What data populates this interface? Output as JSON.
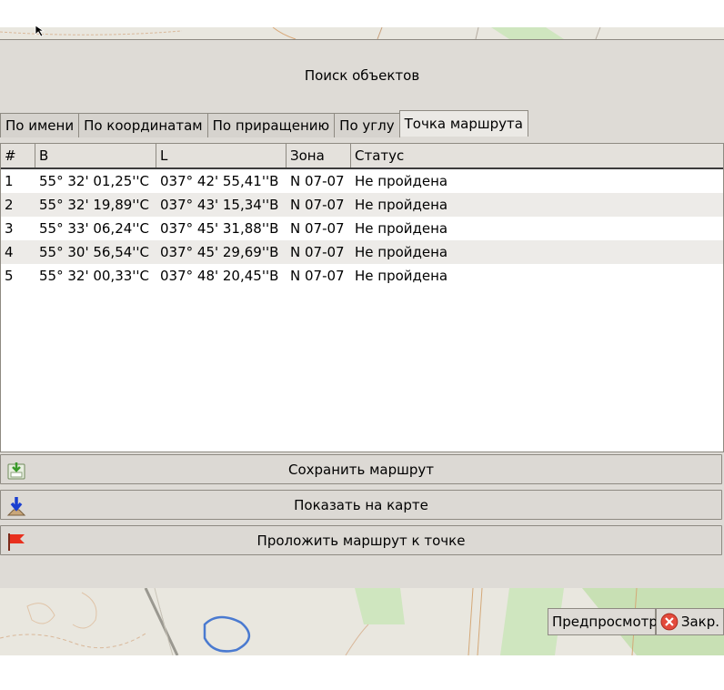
{
  "dialog": {
    "title": "Поиск объектов"
  },
  "tabs": [
    {
      "label": "По имени"
    },
    {
      "label": "По координатам"
    },
    {
      "label": "По приращению"
    },
    {
      "label": "По углу"
    },
    {
      "label": "Точка маршрута",
      "active": true
    }
  ],
  "table": {
    "columns": [
      "#",
      "B",
      "L",
      "Зона",
      "Статус"
    ],
    "rows": [
      [
        "1",
        "55° 32' 01,25''С",
        "037° 42' 55,41''В",
        "N 07-07",
        "Не пройдена"
      ],
      [
        "2",
        "55° 32' 19,89''С",
        "037° 43' 15,34''В",
        "N 07-07",
        "Не пройдена"
      ],
      [
        "3",
        "55° 33' 06,24''С",
        "037° 45' 31,88''В",
        "N 07-07",
        "Не пройдена"
      ],
      [
        "4",
        "55° 30' 56,54''С",
        "037° 45' 29,69''В",
        "N 07-07",
        "Не пройдена"
      ],
      [
        "5",
        "55° 32' 00,33''С",
        "037° 48' 20,45''В",
        "N 07-07",
        "Не пройдена"
      ]
    ]
  },
  "buttons": {
    "save_route": "Сохранить маршрут",
    "show_on_map": "Показать на карте",
    "route_to_point": "Проложить маршрут к точке",
    "preview": "Предпросмотр",
    "close": "Закр."
  },
  "icons": {
    "save": "save-route-icon",
    "show": "show-on-map-icon",
    "route": "red-flag-icon",
    "close": "close-circle-icon"
  },
  "colors": {
    "map_green": "#b9d9a4",
    "flag_red": "#e8301e",
    "close_red": "#e34a3c"
  }
}
